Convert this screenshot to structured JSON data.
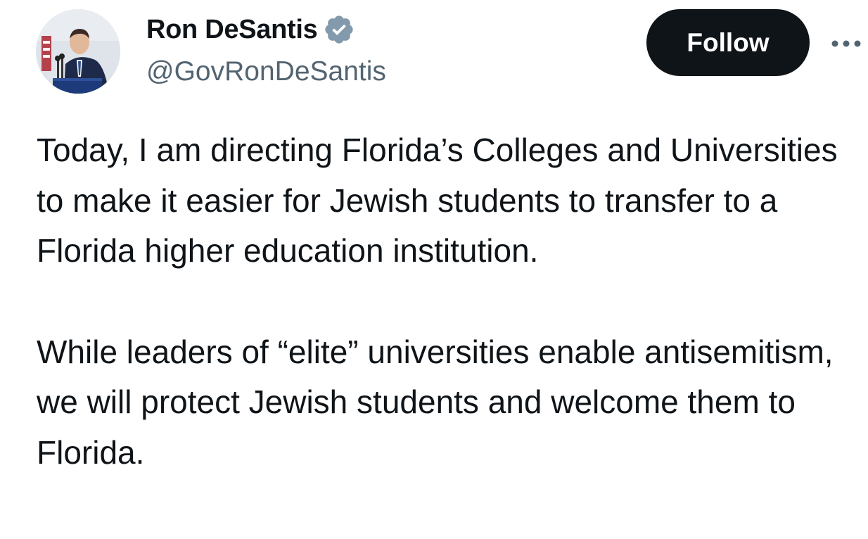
{
  "tweet": {
    "author": {
      "name": "Ron DeSantis",
      "handle": "@GovRonDeSantis",
      "verified_icon": "verified-badge-icon",
      "verified_color": "#829aab"
    },
    "follow_label": "Follow",
    "more_icon": "more-horizontal-icon",
    "paragraphs": [
      "Today, I am directing Florida’s Colleges and Universities to make it easier for Jewish students to transfer to a Florida higher education institution.",
      "While leaders of “elite” universities enable antisemitism, we will protect Jewish students and welcome them to Florida."
    ]
  },
  "colors": {
    "text_primary": "#0f1419",
    "text_secondary": "#536471",
    "button_bg": "#0f1419",
    "button_text": "#ffffff"
  }
}
